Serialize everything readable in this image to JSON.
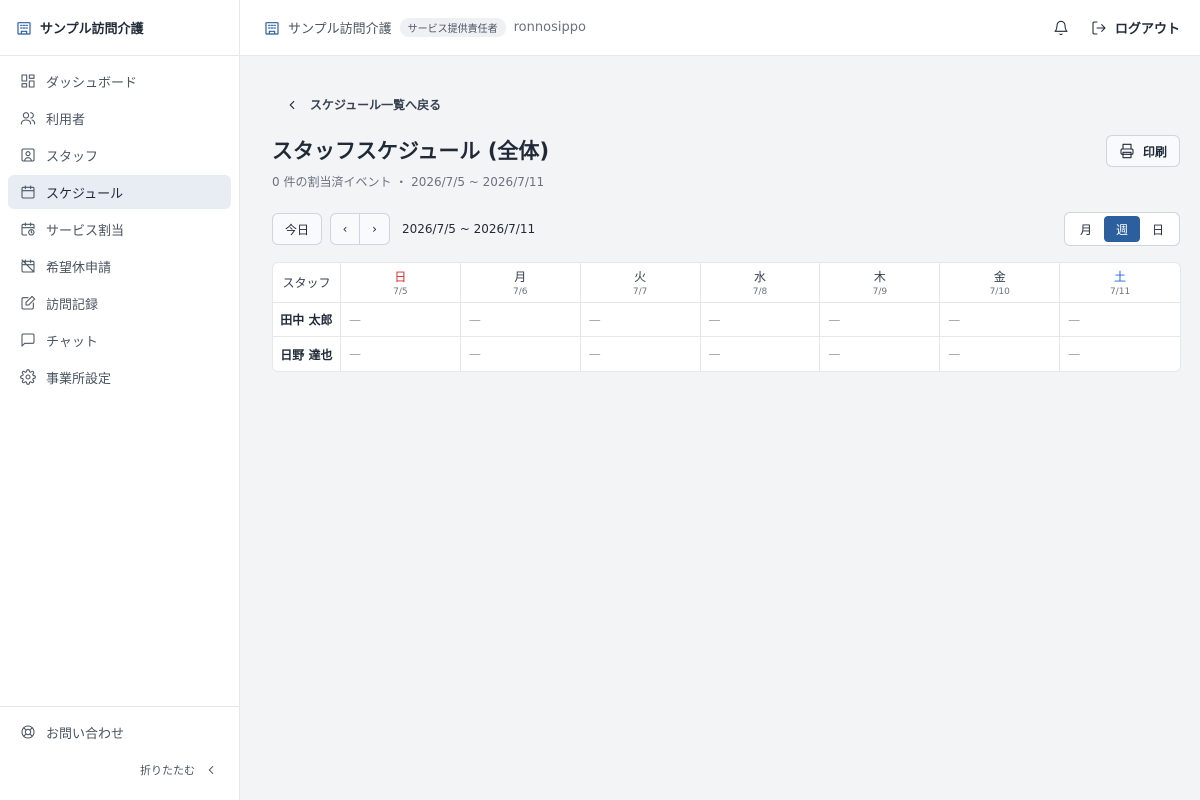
{
  "brand": {
    "name": "サンプル訪問介護"
  },
  "sidebar": {
    "items": [
      {
        "label": "ダッシュボード",
        "icon": "dashboard-icon"
      },
      {
        "label": "利用者",
        "icon": "users-icon"
      },
      {
        "label": "スタッフ",
        "icon": "staff-icon"
      },
      {
        "label": "スケジュール",
        "icon": "calendar-icon",
        "active": true
      },
      {
        "label": "サービス割当",
        "icon": "calendar-clock-icon"
      },
      {
        "label": "希望休申請",
        "icon": "calendar-off-icon"
      },
      {
        "label": "訪問記録",
        "icon": "edit-note-icon"
      },
      {
        "label": "チャット",
        "icon": "chat-icon"
      },
      {
        "label": "事業所設定",
        "icon": "gear-icon"
      }
    ],
    "contact_label": "お問い合わせ",
    "collapse_label": "折りたたむ"
  },
  "header": {
    "org_name": "サンプル訪問介護",
    "role": "サービス提供責任者",
    "username": "ronnosippo",
    "logout_label": "ログアウト"
  },
  "page": {
    "back_label": "スケジュール一覧へ戻る",
    "title": "スタッフスケジュール (全体)",
    "subtitle": "0 件の割当済イベント ・ 2026/7/5 ~ 2026/7/11",
    "print_label": "印刷",
    "today_label": "今日",
    "prev_label": "‹",
    "next_label": "›",
    "range_label": "2026/7/5 ~ 2026/7/11",
    "views": {
      "month": "月",
      "week": "週",
      "day": "日",
      "active": "week"
    }
  },
  "table": {
    "staff_header": "スタッフ",
    "days": [
      {
        "name": "日",
        "date": "7/5"
      },
      {
        "name": "月",
        "date": "7/6"
      },
      {
        "name": "火",
        "date": "7/7"
      },
      {
        "name": "水",
        "date": "7/8"
      },
      {
        "name": "木",
        "date": "7/9"
      },
      {
        "name": "金",
        "date": "7/10"
      },
      {
        "name": "土",
        "date": "7/11"
      }
    ],
    "rows": [
      {
        "staff": "田中 太郎",
        "cells": [
          "—",
          "—",
          "—",
          "—",
          "—",
          "—",
          "—"
        ]
      },
      {
        "staff": "日野 達也",
        "cells": [
          "—",
          "—",
          "—",
          "—",
          "—",
          "—",
          "—"
        ]
      }
    ]
  },
  "colors": {
    "accent": "#2b5f9e",
    "sunday": "#dc2626",
    "saturday": "#2563eb"
  }
}
